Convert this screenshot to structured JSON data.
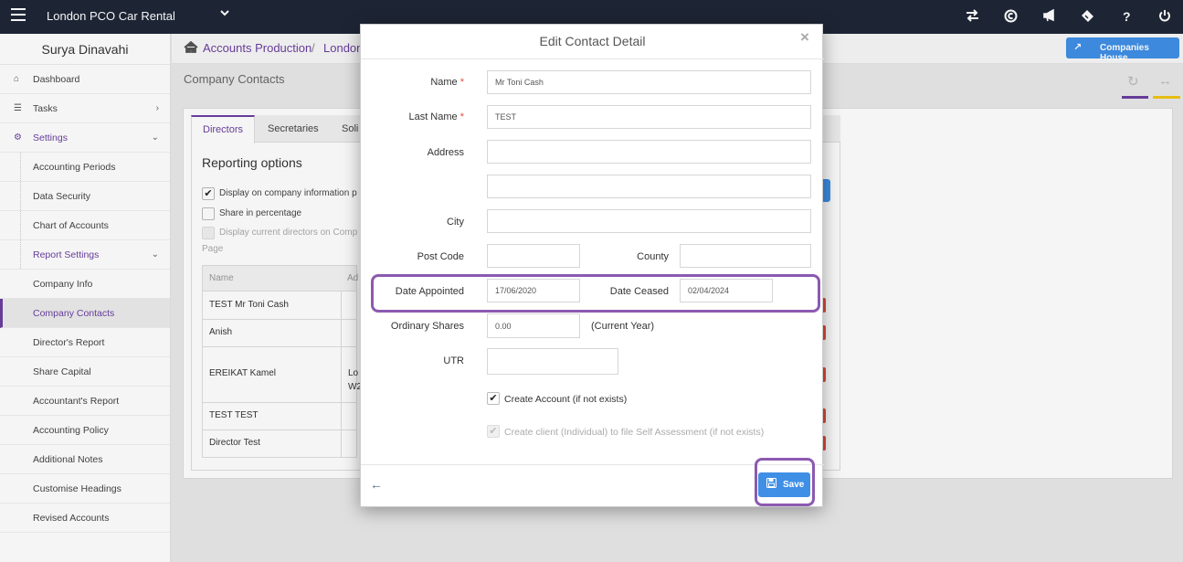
{
  "topbar": {
    "app_title": "London PCO Car Rental",
    "icons": [
      "menu-icon",
      "chevron-down-icon",
      "transfer-icon",
      "copyright-icon",
      "megaphone-icon",
      "ticket-icon",
      "help-icon",
      "power-icon"
    ],
    "help_glyph": "?"
  },
  "sidebar": {
    "user_name": "Surya Dinavahi",
    "items": [
      {
        "label": "Dashboard"
      },
      {
        "label": "Tasks"
      },
      {
        "label": "Settings"
      },
      {
        "label": "Accounting Periods"
      },
      {
        "label": "Data Security"
      },
      {
        "label": "Chart of Accounts"
      },
      {
        "label": "Report Settings"
      },
      {
        "label": "Company Info"
      },
      {
        "label": "Company Contacts"
      },
      {
        "label": "Director's Report"
      },
      {
        "label": "Share Capital"
      },
      {
        "label": "Accountant's Report"
      },
      {
        "label": "Accounting Policy"
      },
      {
        "label": "Additional Notes"
      },
      {
        "label": "Customise Headings"
      },
      {
        "label": "Revised Accounts"
      }
    ]
  },
  "breadcrumb": {
    "item1": "Accounts Production",
    "separator": "/",
    "item2": "London"
  },
  "header_button": {
    "label": "Companies House"
  },
  "page": {
    "title": "Company Contacts",
    "tabs": [
      {
        "label": "Directors"
      },
      {
        "label": "Secretaries"
      },
      {
        "label": "Soli"
      }
    ],
    "reporting_title": "Reporting options",
    "options": {
      "display_info": "Display on company information p",
      "share_percentage": "Share in percentage",
      "current_directors": "Display current directors on Comp",
      "page_word": "Page"
    },
    "table": {
      "headers": [
        "Name",
        "Ad"
      ],
      "rows": [
        {
          "name": "TEST Mr Toni Cash",
          "addr1": "",
          "addr2": ""
        },
        {
          "name": "Anish",
          "addr1": "",
          "addr2": ""
        },
        {
          "name": "EREIKAT Kamel",
          "addr1": "Lo",
          "addr2": "W2"
        },
        {
          "name": "TEST TEST",
          "addr1": "",
          "addr2": ""
        },
        {
          "name": "Director Test",
          "addr1": "",
          "addr2": ""
        }
      ]
    }
  },
  "modal": {
    "title": "Edit Contact Detail",
    "close": "×",
    "required_mark": "*",
    "fields": {
      "name_label": "Name",
      "name_value": "Mr Toni Cash",
      "last_name_label": "Last Name",
      "last_name_value": "TEST",
      "address_label": "Address",
      "address1_value": "",
      "address2_value": "",
      "city_label": "City",
      "city_value": "",
      "post_code_label": "Post Code",
      "post_code_value": "",
      "county_label": "County",
      "county_value": "",
      "date_appointed_label": "Date Appointed",
      "date_appointed_value": "17/06/2020",
      "date_ceased_label": "Date Ceased",
      "date_ceased_value": "02/04/2024",
      "ordinary_shares_label": "Ordinary Shares",
      "ordinary_shares_value": "0.00",
      "current_year_note": "(Current Year)",
      "utr_label": "UTR",
      "utr_value": ""
    },
    "create_account_label": "Create Account (if not exists)",
    "create_account_checked": true,
    "create_client_label": "Create client (Individual) to file Self Assessment (if not exists)",
    "create_client_checked": true,
    "save_label": "Save"
  },
  "colors": {
    "topbar": "#1f2738",
    "accent_purple": "#6b3fa0",
    "highlight": "#8c5ab1",
    "primary_blue": "#3f8fe6",
    "danger_red": "#e04b3a",
    "accent_yellow": "#f2c514"
  }
}
